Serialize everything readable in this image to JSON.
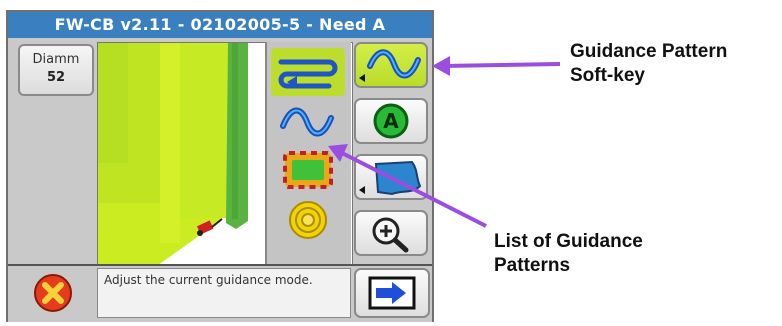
{
  "device": {
    "title": "FW-CB v2.11 - 02102005-5 - Need A",
    "diameter_label": "Diamm",
    "diameter_value": "52",
    "message": "Adjust the current guidance mode."
  },
  "soft_keys": [
    "guidance-pattern-curve",
    "a-point",
    "boundary",
    "zoom-in",
    "next"
  ],
  "pattern_list": [
    "back-and-forth",
    "curve",
    "field-boundary",
    "pivot"
  ],
  "annotations": {
    "guidance_soft_key": [
      "Guidance Pattern",
      "Soft-key"
    ],
    "pattern_list": [
      "List of Guidance",
      "Patterns"
    ]
  },
  "colors": {
    "title_bar": "#3a7fc0",
    "callout_arrow": "#9b4de0",
    "field_yellow": "#ccec22",
    "field_green": "#58b340",
    "selected_highlight": "#bcdd2c"
  }
}
